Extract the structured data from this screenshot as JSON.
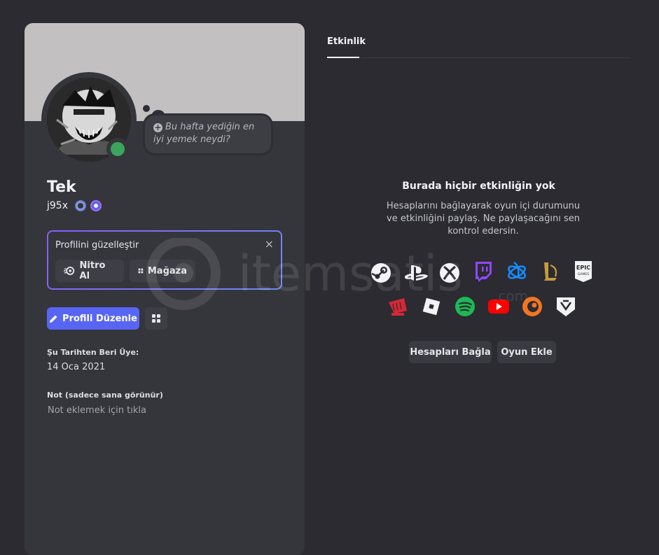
{
  "profile": {
    "display_name": "Tek",
    "username": "j95x",
    "status_bubble": "Bu hafta yediğin en iyi yemek neydi?",
    "promo": {
      "title": "Profilini güzelleştir",
      "close": "×",
      "nitro_label": "Nitro Al",
      "shop_label": "Mağaza"
    },
    "edit_label": "Profili Düzenle",
    "member_since_label": "Şu Tarihten Beri Üye:",
    "member_since_value": "14 Oca 2021",
    "note_label": "Not (sadece sana görünür)",
    "note_placeholder": "Not eklemek için tıkla"
  },
  "activity": {
    "tab_label": "Etkinlik",
    "empty_title": "Burada hiçbir etkinliğin yok",
    "empty_desc": "Hesaplarını bağlayarak oyun içi durumunu ve etkinliğini paylaş. Ne paylaşacağını sen kontrol edersin.",
    "connect_label": "Hesapları Bağla",
    "add_game_label": "Oyun Ekle",
    "icons": [
      "steam-icon",
      "playstation-icon",
      "xbox-icon",
      "twitch-icon",
      "battlenet-icon",
      "league-icon",
      "epic-games-icon",
      "riot-icon",
      "roblox-icon",
      "spotify-icon",
      "youtube-icon",
      "crunchyroll-icon",
      "bungie-icon"
    ]
  },
  "watermark": {
    "text": "itemsatis",
    "sub": ".com"
  },
  "colors": {
    "accent": "#5865f2",
    "online": "#3ba55d",
    "banner": "#c3c0c1"
  }
}
